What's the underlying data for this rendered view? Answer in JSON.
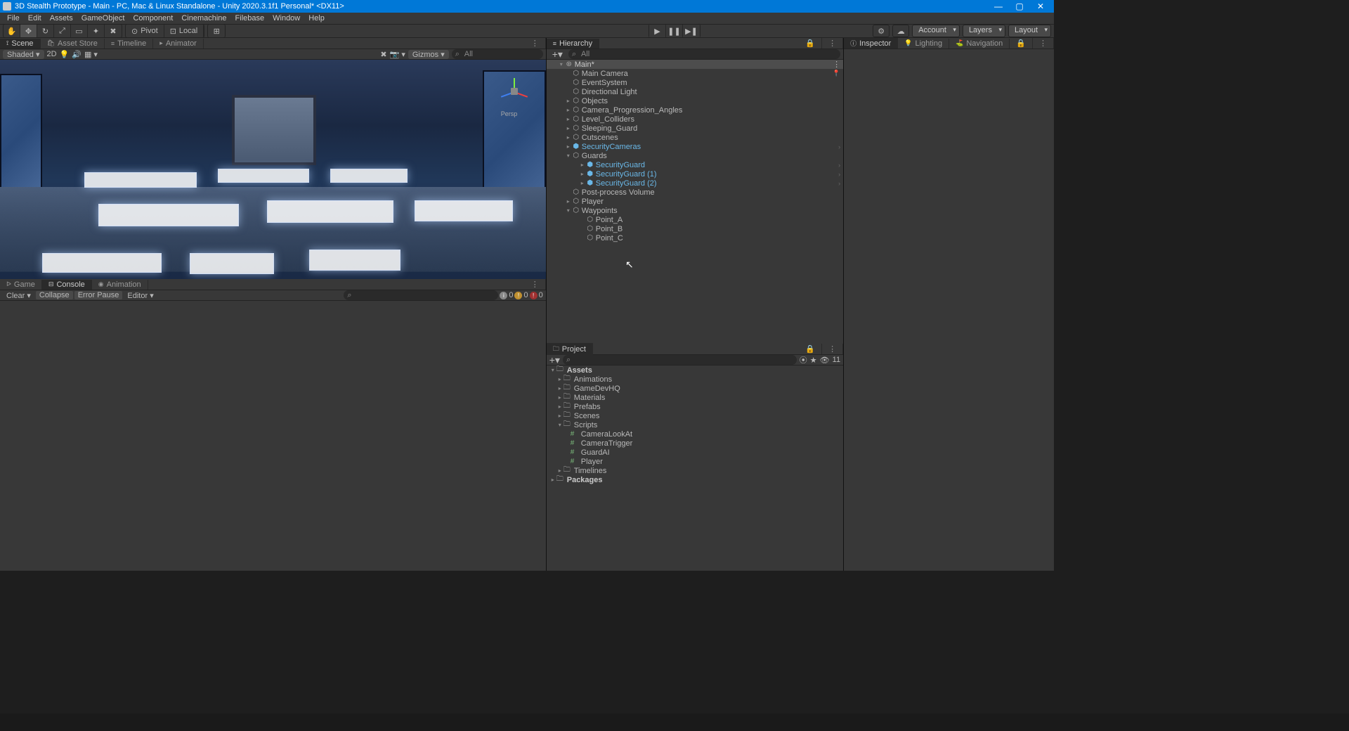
{
  "title": "3D Stealth Prototype - Main - PC, Mac & Linux Standalone - Unity 2020.3.1f1 Personal* <DX11>",
  "menu": [
    "File",
    "Edit",
    "Assets",
    "GameObject",
    "Component",
    "Cinemachine",
    "Filebase",
    "Window",
    "Help"
  ],
  "handles": {
    "pivot": "Pivot",
    "local": "Local"
  },
  "rightctrls": {
    "account": "Account",
    "layers": "Layers",
    "layout": "Layout"
  },
  "sceneTabs": {
    "scene": "Scene",
    "asset": "Asset Store",
    "timeline": "Timeline",
    "animator": "Animator"
  },
  "sceneToolbar": {
    "shaded": "Shaded",
    "twoD": "2D",
    "gizmos": "Gizmos",
    "all": "All"
  },
  "gizmo": {
    "persp": "Persp"
  },
  "consoleTabs": {
    "game": "Game",
    "console": "Console",
    "animation": "Animation"
  },
  "consoleTb": {
    "clear": "Clear",
    "collapse": "Collapse",
    "errorPause": "Error Pause",
    "editor": "Editor",
    "info": "0",
    "warn": "0",
    "err": "0"
  },
  "hierTab": "Hierarchy",
  "hierSearch": "All",
  "hierarchy": {
    "scene": "Main*",
    "mainCamera": "Main Camera",
    "eventSystem": "EventSystem",
    "dirLight": "Directional Light",
    "objects": "Objects",
    "camProg": "Camera_Progression_Angles",
    "levelCol": "Level_Colliders",
    "sleeping": "Sleeping_Guard",
    "cutscenes": "Cutscenes",
    "secCams": "SecurityCameras",
    "guards": "Guards",
    "sg": "SecurityGuard",
    "sg1": "SecurityGuard (1)",
    "sg2": "SecurityGuard (2)",
    "postproc": "Post-process Volume",
    "player": "Player",
    "waypoints": "Waypoints",
    "pa": "Point_A",
    "pb": "Point_B",
    "pc": "Point_C"
  },
  "projectTab": "Project",
  "projSlider": "11",
  "project": {
    "assets": "Assets",
    "anim": "Animations",
    "gdhq": "GameDevHQ",
    "mat": "Materials",
    "prefabs": "Prefabs",
    "scenes": "Scenes",
    "scripts": "Scripts",
    "camLook": "CameraLookAt",
    "camTrig": "CameraTrigger",
    "guardAI": "GuardAI",
    "playerS": "Player",
    "timelines": "Timelines",
    "packages": "Packages"
  },
  "inspectorTabs": {
    "inspector": "Inspector",
    "lighting": "Lighting",
    "navigation": "Navigation"
  }
}
